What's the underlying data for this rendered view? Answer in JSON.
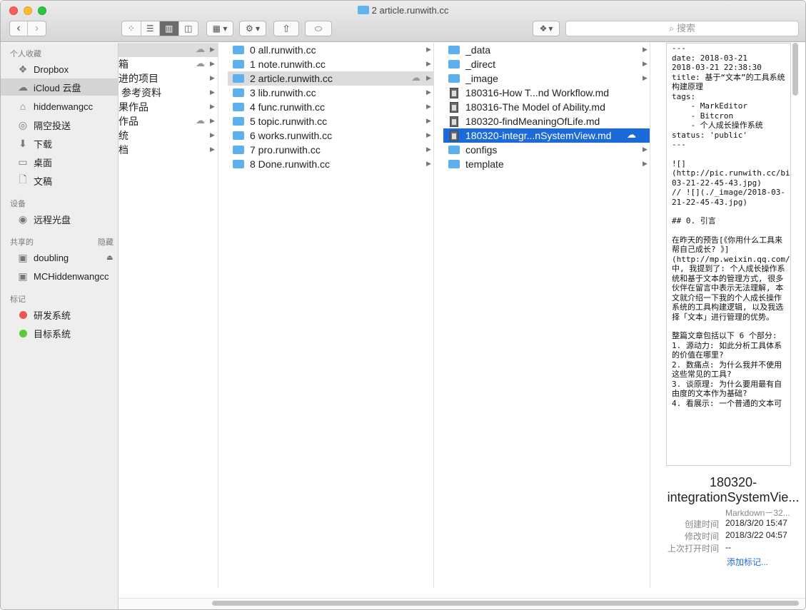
{
  "window": {
    "title": "2 article.runwith.cc"
  },
  "toolbar": {
    "back": "‹",
    "forward": "›",
    "views": [
      "icon",
      "list",
      "column",
      "gallery"
    ],
    "active_view": "column",
    "arrange_label": "▦ ▾",
    "action_label": "⚙ ▾",
    "share_label": "⇧",
    "tag_label": "⬭",
    "dropbox_label": "▾",
    "search_placeholder": "搜索"
  },
  "sidebar": {
    "favorites_header": "个人收藏",
    "favorites": [
      {
        "label": "Dropbox",
        "icon": "dropbox-icon"
      },
      {
        "label": "iCloud 云盘",
        "icon": "cloud-icon"
      },
      {
        "label": "hiddenwangcc",
        "icon": "home-icon"
      },
      {
        "label": "隔空投送",
        "icon": "airdrop-icon"
      },
      {
        "label": "下载",
        "icon": "download-icon"
      },
      {
        "label": "桌面",
        "icon": "desktop-icon"
      },
      {
        "label": "文稿",
        "icon": "documents-icon"
      }
    ],
    "devices_header": "设备",
    "devices": [
      {
        "label": "远程光盘",
        "icon": "disc-icon"
      }
    ],
    "shared_header": "共享的",
    "shared_hide": "隐藏",
    "shared": [
      {
        "label": "doubling",
        "icon": "monitor-icon"
      },
      {
        "label": "MCHiddenwangcc",
        "icon": "monitor-icon"
      }
    ],
    "tags_header": "标记",
    "tags": [
      {
        "label": "研发系统",
        "color": "#f0554f"
      },
      {
        "label": "目标系统",
        "color": "#5cc93b"
      }
    ]
  },
  "column1": [
    "",
    "箱",
    "进的项目",
    "参考资料",
    "果作品",
    "作品",
    "统",
    "档"
  ],
  "column2": [
    "0 all.runwith.cc",
    "1 note.runwith.cc",
    "2 article.runwith.cc",
    "3 lib.runwith.cc",
    "4 func.runwith.cc",
    "5 topic.runwith.cc",
    "6 works.runwith.cc",
    "7 pro.runwith.cc",
    "8 Done.runwith.cc"
  ],
  "column3": [
    {
      "name": "_data",
      "type": "folder"
    },
    {
      "name": "_direct",
      "type": "folder"
    },
    {
      "name": "_image",
      "type": "folder"
    },
    {
      "name": "180316-How T...nd Workflow.md",
      "type": "file"
    },
    {
      "name": "180316-The Model of Ability.md",
      "type": "file"
    },
    {
      "name": "180320-findMeaningOfLife.md",
      "type": "file"
    },
    {
      "name": "180320-integr...nSystemView.md",
      "type": "file"
    },
    {
      "name": "configs",
      "type": "folder"
    },
    {
      "name": "template",
      "type": "folder"
    }
  ],
  "preview": {
    "lines": [
      "---",
      "date: 2018-03-21",
      "2018-03-21 22:38:30",
      "title: 基于“文本”的工具系统构建原理",
      "tags:",
      "    - MarkEditor",
      "    - Bitcron",
      "    - 个人成长操作系统",
      "status: 'public'",
      "---",
      "",
      "![](http://pic.runwith.cc/bitcron/2018-03-21-22-45-43.jpg)",
      "// ![](./_image/2018-03-21-22-45-43.jpg)",
      "",
      "## 0. 引言",
      "",
      "在昨天的预告[《你用什么工具来帮自己成长? 》](http://mp.weixin.qq.com/s/Dv8rdFdcyiEXhGg5YuUH_w)中, 我提到了: 个人成长操作系统和基于文本的管理方式, 很多伙伴在留言中表示无法理解, 本文就介绍一下我的个人成长操作系统的工具构建逻辑, 以及我选择「文本」进行管理的优势。",
      "",
      "整篇文章包括以下 6 个部分:",
      "1. 源动力: 如此分析工具体系的价值在哪里?",
      "2. 数痛点: 为什么我并不使用这些常见的工具?",
      "3. 谈原理: 为什么要用最有自由度的文本作为基础?",
      "4. 看展示: 一个普通的文本可"
    ],
    "name_line1": "180320-",
    "name_line2": "integrationSystemVie...",
    "kind": "Markdown－32...",
    "created_label": "创建时间",
    "created": "2018/3/20 15:47",
    "modified_label": "修改时间",
    "modified": "2018/3/22 04:57",
    "opened_label": "上次打开时间",
    "opened": "--",
    "add_tags": "添加标记..."
  }
}
